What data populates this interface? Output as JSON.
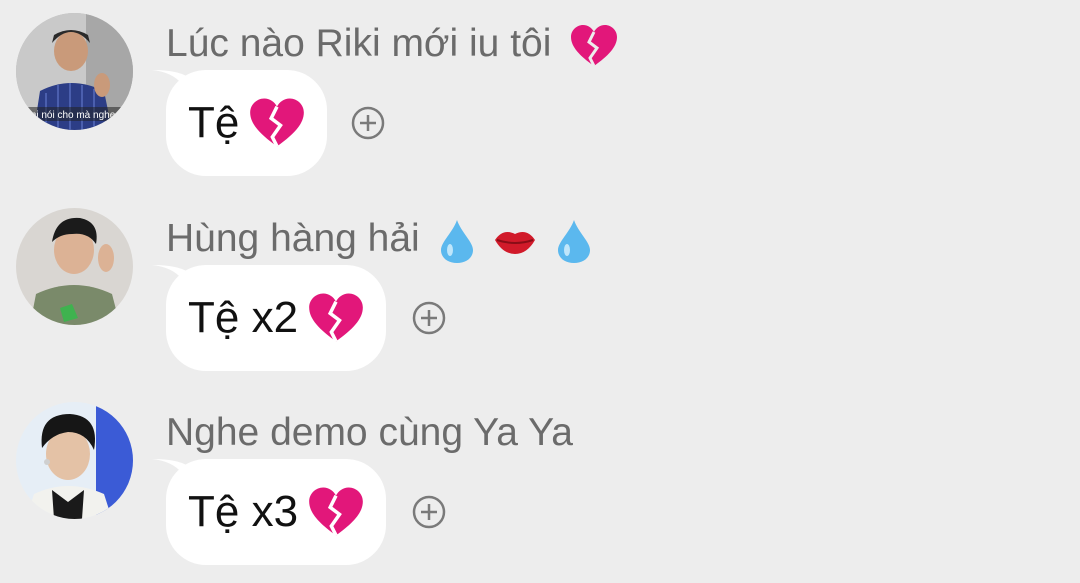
{
  "messages": [
    {
      "sender": "Lúc nào Riki mới iu tôi",
      "sender_emojis": [
        "broken-heart"
      ],
      "text": "Tệ",
      "text_emojis": [
        "broken-heart"
      ],
      "avatar_caption": "mị nói cho mà nghe"
    },
    {
      "sender": "Hùng hàng hải",
      "sender_emojis": [
        "droplet",
        "lips",
        "droplet"
      ],
      "text": "Tệ x2",
      "text_emojis": [
        "broken-heart"
      ]
    },
    {
      "sender": "Nghe demo cùng Ya Ya",
      "sender_emojis": [],
      "text": "Tệ x3",
      "text_emojis": [
        "broken-heart"
      ]
    }
  ],
  "icons": {
    "add_reaction": "plus-circle-icon"
  },
  "colors": {
    "background": "#ededed",
    "bubble": "#ffffff",
    "sender_text": "#6b6b6b",
    "heart": "#e2177a"
  }
}
